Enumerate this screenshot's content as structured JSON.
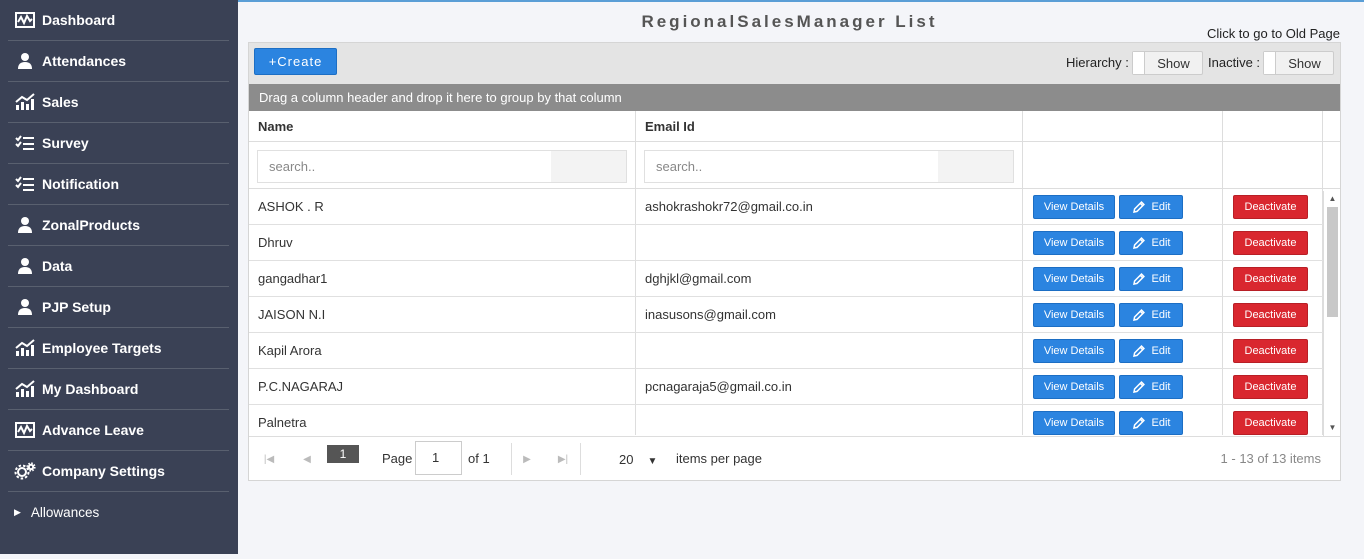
{
  "sidebar": {
    "items": [
      {
        "label": "Dashboard",
        "icon": "activity-icon"
      },
      {
        "label": "Attendances",
        "icon": "user-icon"
      },
      {
        "label": "Sales",
        "icon": "chart-icon"
      },
      {
        "label": "Survey",
        "icon": "checklist-icon"
      },
      {
        "label": "Notification",
        "icon": "checklist-icon"
      },
      {
        "label": "ZonalProducts",
        "icon": "user-icon"
      },
      {
        "label": "Data",
        "icon": "user-icon"
      },
      {
        "label": "PJP Setup",
        "icon": "user-icon"
      },
      {
        "label": "Employee Targets",
        "icon": "chart-icon"
      },
      {
        "label": "My Dashboard",
        "icon": "chart-icon"
      },
      {
        "label": "Advance Leave",
        "icon": "activity-icon"
      },
      {
        "label": "Company Settings",
        "icon": "gears-icon"
      },
      {
        "label": "Allowances",
        "icon": "caret-right-icon"
      }
    ]
  },
  "header": {
    "title": "RegionalSalesManager  List",
    "old_page_link": "Click to go to Old Page"
  },
  "toolbar": {
    "create_label": "+Create",
    "hierarchy_label": "Hierarchy :",
    "hierarchy_toggle": "Show",
    "inactive_label": "Inactive :",
    "inactive_toggle": "Show"
  },
  "grid": {
    "group_hint": "Drag a column header and drop it here to group by that column",
    "columns": [
      "Name",
      "Email Id",
      "",
      ""
    ],
    "filters": {
      "name_placeholder": "search..",
      "email_placeholder": "search.."
    },
    "action_labels": {
      "view": "View Details",
      "edit": "Edit",
      "deactivate": "Deactivate"
    },
    "rows": [
      {
        "name": "ASHOK . R",
        "email": "ashokrashokr72@gmail.co.in"
      },
      {
        "name": "Dhruv",
        "email": ""
      },
      {
        "name": "gangadhar1",
        "email": "dghjkl@gmail.com"
      },
      {
        "name": "JAISON N.I",
        "email": "inasusons@gmail.com"
      },
      {
        "name": "Kapil Arora",
        "email": ""
      },
      {
        "name": "P.C.NAGARAJ",
        "email": "pcnagaraja5@gmail.co.in"
      },
      {
        "name": "Palnetra",
        "email": ""
      }
    ]
  },
  "pager": {
    "current_page": "1",
    "page_label": "Page",
    "page_input": "1",
    "of_label": "of 1",
    "page_size": "20",
    "per_page_label": "items per page",
    "info": "1 - 13 of 13 items"
  },
  "colors": {
    "sidebar_bg": "#3a4155",
    "primary": "#2b84e0",
    "danger": "#d9272f",
    "group_bar": "#8c8c8c"
  }
}
